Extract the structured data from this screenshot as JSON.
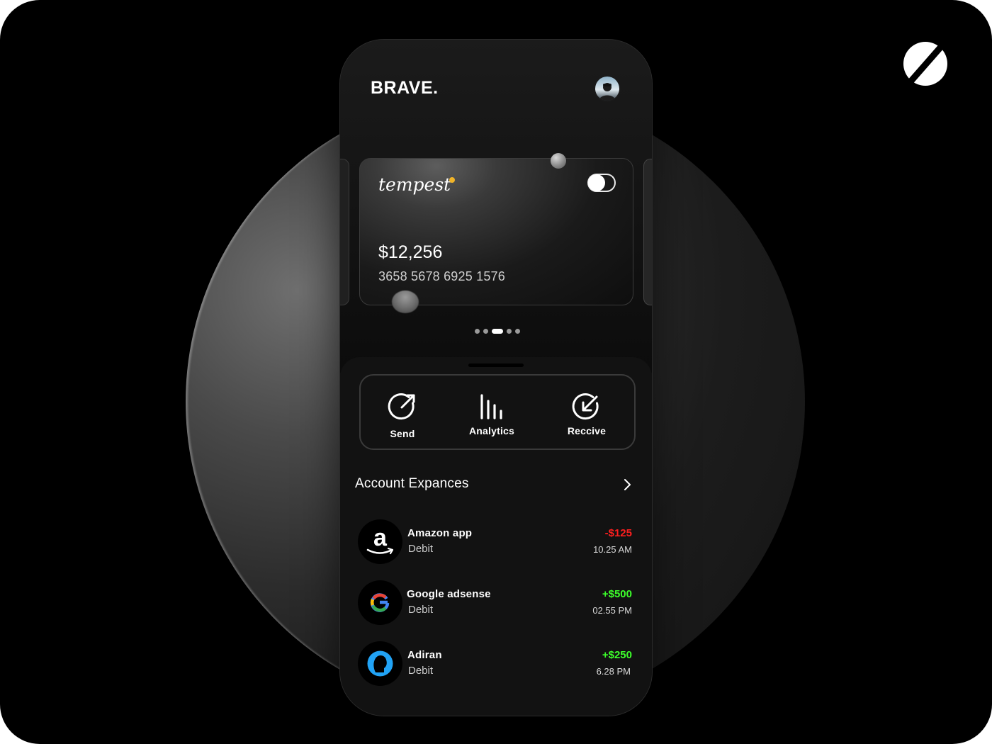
{
  "app": {
    "logo_text": "BRAVE."
  },
  "card": {
    "brand": "tempest",
    "balance": "$12,256",
    "number": "3658 5678 6925 1576",
    "toggle_on": true
  },
  "carousel": {
    "dot_count": 5,
    "active_index": 2
  },
  "actions": [
    {
      "label": "Send",
      "icon": "send-arrow-icon"
    },
    {
      "label": "Analytics",
      "icon": "analytics-bars-icon"
    },
    {
      "label": "Reccive",
      "icon": "receive-arrow-icon"
    }
  ],
  "expenses": {
    "title": "Account Expances",
    "items": [
      {
        "name": "Amazon app",
        "type": "Debit",
        "amount": "-$125",
        "time": "10.25 AM",
        "color": "#ff1f1f",
        "icon": "amazon-logo-icon"
      },
      {
        "name": "Google adsense",
        "type": "Debit",
        "amount": "+$500",
        "time": "02.55 PM",
        "color": "#3dff2b",
        "icon": "google-logo-icon"
      },
      {
        "name": "Adiran",
        "type": "Debit",
        "amount": "+$250",
        "time": "6.28 PM",
        "color": "#3dff2b",
        "icon": "person-profile-icon"
      }
    ]
  },
  "colors": {
    "background": "#000000",
    "negative": "#ff1f1f",
    "positive": "#3dff2b",
    "card_brand_dot": "#f0b429"
  }
}
